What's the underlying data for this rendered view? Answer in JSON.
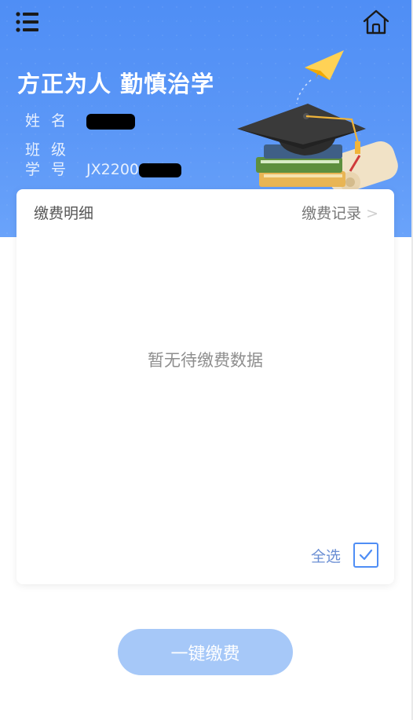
{
  "header": {
    "motto": "方正为人 勤慎治学",
    "name_label": "姓名",
    "class_label": "班级",
    "id_label": "学号",
    "id_prefix": "JX2200",
    "menu_icon": "menu-icon",
    "home_icon": "home-icon"
  },
  "card": {
    "title": "缴费明细",
    "records_link": "缴费记录",
    "chevron": ">",
    "empty_message": "暂无待缴费数据",
    "select_all_label": "全选",
    "select_all_checked": true
  },
  "footer": {
    "pay_button": "一键缴费"
  },
  "colors": {
    "header_blue": "#4f8ef5",
    "button_light_blue": "#a6c8f8",
    "checkbox_blue": "#4f8ef5"
  }
}
